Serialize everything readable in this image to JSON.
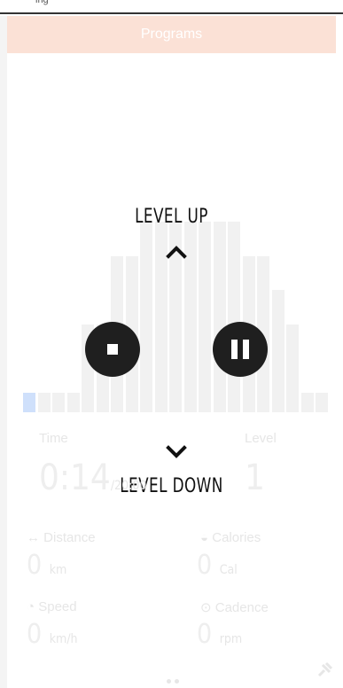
{
  "header": {
    "title": "Programs"
  },
  "top_snippet": "ing",
  "controls": {
    "level_up_label": "LEVEL UP",
    "level_down_label": "LEVEL DOWN"
  },
  "workout": {
    "time_label": "Time",
    "time_value": "0:14",
    "time_total": "/20:00",
    "level_label": "Level",
    "level_value": "1"
  },
  "stats": {
    "distance_label": "Distance",
    "distance_value": "0",
    "distance_unit": "km",
    "calories_label": "Calories",
    "calories_value": "0",
    "calories_unit": "Cal",
    "speed_label": "Speed",
    "speed_value": "0",
    "speed_unit": "km/h",
    "cadence_label": "Cadence",
    "cadence_value": "0",
    "cadence_unit": "rpm"
  },
  "program_profile": {
    "levels": [
      1,
      1,
      1,
      1,
      3,
      3,
      5,
      5,
      6,
      6,
      6,
      6,
      6,
      6,
      6,
      5,
      5,
      4,
      3,
      1,
      1
    ]
  },
  "icons": [
    "chevron-up-icon",
    "chevron-down-icon",
    "stop-icon",
    "pause-icon",
    "pin-icon"
  ]
}
